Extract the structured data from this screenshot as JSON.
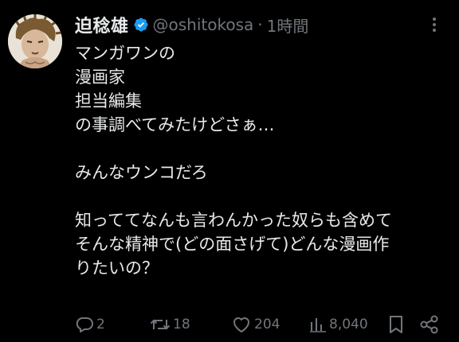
{
  "author": {
    "display_name": "迫稔雄",
    "handle": "@oshitokosa",
    "separator": "·",
    "time": "1時間"
  },
  "body_lines": [
    "マンガワンの",
    "漫画家",
    "担当編集",
    "の事調べてみたけどさぁ…",
    "",
    "みんなウンコだろ",
    "",
    "知っててなんも言わんかった奴らも含めて",
    "そんな精神で(どの面さげて)どんな漫画作",
    "りたいの？"
  ],
  "actions": {
    "replies": "2",
    "reposts": "18",
    "likes": "204",
    "views": "8,040"
  },
  "icons": {
    "verified": "verified-badge-icon",
    "more": "more-icon",
    "reply": "reply-icon",
    "repost": "repost-icon",
    "like": "heart-icon",
    "views": "views-icon",
    "bookmark": "bookmark-icon",
    "share": "share-icon"
  },
  "colors": {
    "background": "#000000",
    "text": "#e7e9ea",
    "secondary": "#71767b",
    "verified": "#1d9bf0"
  }
}
